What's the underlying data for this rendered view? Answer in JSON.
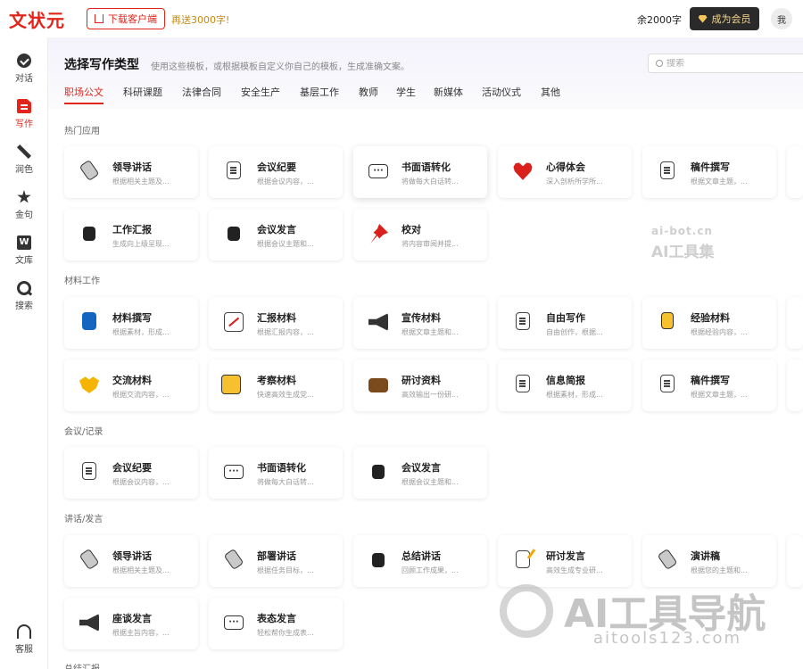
{
  "header": {
    "logo": "文状元",
    "download_label": "下载客户端",
    "gift_text": "再送3000字!",
    "balance": "余2000字",
    "vip_label": "成为会员",
    "avatar_text": "我"
  },
  "sidebar": {
    "items": [
      {
        "label": "对话",
        "icon": "chat-icon"
      },
      {
        "label": "写作",
        "icon": "write-icon",
        "active": true
      },
      {
        "label": "润色",
        "icon": "polish-icon"
      },
      {
        "label": "金句",
        "icon": "star-icon"
      },
      {
        "label": "文库",
        "icon": "library-icon"
      },
      {
        "label": "搜索",
        "icon": "search-icon"
      }
    ],
    "support": {
      "label": "客服",
      "icon": "headset-icon"
    }
  },
  "main": {
    "title": "选择写作类型",
    "subtitle": "使用这些模板，或根据模板自定义你自己的模板，生成准确文案。",
    "search_placeholder": "搜索",
    "tabs": [
      "职场公文",
      "科研课题",
      "法律合同",
      "安全生产",
      "基层工作",
      "教师",
      "学生",
      "新媒体",
      "活动仪式",
      "其他"
    ],
    "active_tab": "职场公文",
    "sections": [
      {
        "title": "热门应用",
        "cards": [
          {
            "title": "领导讲话",
            "desc": "根据相关主题及...",
            "icon": "microphone-icon"
          },
          {
            "title": "会议纪要",
            "desc": "根据会议内容，...",
            "icon": "document-icon"
          },
          {
            "title": "书面语转化",
            "desc": "将做每大白话转...",
            "icon": "speech-bubble-icon"
          },
          {
            "title": "心得体会",
            "desc": "深入剖析所学所...",
            "icon": "heart-icon"
          },
          {
            "title": "稿件撰写",
            "desc": "根据文章主题，...",
            "icon": "document-icon"
          },
          {
            "title": "工作汇报",
            "desc": "生成向上级呈现...",
            "icon": "speaking-head-icon"
          },
          {
            "title": "会议发言",
            "desc": "根据会议主题和...",
            "icon": "speaking-head-icon"
          },
          {
            "title": "校对",
            "desc": "将内容审阅并提...",
            "icon": "pushpin-icon"
          }
        ]
      },
      {
        "title": "材料工作",
        "cards": [
          {
            "title": "材料撰写",
            "desc": "根据素材，形成...",
            "icon": "book-icon"
          },
          {
            "title": "汇报材料",
            "desc": "根据汇报内容，...",
            "icon": "chart-icon"
          },
          {
            "title": "宣传材料",
            "desc": "根据文章主题和...",
            "icon": "megaphone-icon"
          },
          {
            "title": "自由写作",
            "desc": "自由创作，根据...",
            "icon": "document-icon"
          },
          {
            "title": "经验材料",
            "desc": "根据经验内容，...",
            "icon": "lightbulb-icon"
          },
          {
            "title": "交流材料",
            "desc": "根据交流内容，...",
            "icon": "handshake-icon"
          },
          {
            "title": "考察材料",
            "desc": "快速高效生成党...",
            "icon": "technologist-icon"
          },
          {
            "title": "研讨资料",
            "desc": "高效输出一份研...",
            "icon": "briefcase-icon"
          },
          {
            "title": "信息简报",
            "desc": "根据素材，形成...",
            "icon": "document-icon"
          },
          {
            "title": "稿件撰写",
            "desc": "根据文章主题，...",
            "icon": "document-icon"
          }
        ]
      },
      {
        "title": "会议/记录",
        "cards": [
          {
            "title": "会议纪要",
            "desc": "根据会议内容，...",
            "icon": "document-icon"
          },
          {
            "title": "书面语转化",
            "desc": "将做每大白话转...",
            "icon": "speech-bubble-icon"
          },
          {
            "title": "会议发言",
            "desc": "根据会议主题和...",
            "icon": "speaking-head-icon"
          }
        ]
      },
      {
        "title": "讲话/发言",
        "cards": [
          {
            "title": "领导讲话",
            "desc": "根据相关主题及...",
            "icon": "microphone-icon"
          },
          {
            "title": "部署讲话",
            "desc": "根据任务目标，...",
            "icon": "microphone-icon"
          },
          {
            "title": "总结讲话",
            "desc": "回顾工作成果，...",
            "icon": "speaking-head-icon"
          },
          {
            "title": "研讨发言",
            "desc": "高效生成专业研...",
            "icon": "memo-icon"
          },
          {
            "title": "演讲稿",
            "desc": "根据您的主题和...",
            "icon": "microphone-icon"
          },
          {
            "title": "座谈发言",
            "desc": "根据主旨内容，...",
            "icon": "megaphone-icon"
          },
          {
            "title": "表态发言",
            "desc": "轻松帮你生成表...",
            "icon": "speech-bubble-icon"
          }
        ]
      },
      {
        "title": "总结汇报"
      }
    ]
  },
  "watermarks": {
    "top_domain": "ai-bot.cn",
    "top_name": "AI工具集",
    "bottom_name": "AI工具导航",
    "bottom_domain": "aitools123.com"
  }
}
